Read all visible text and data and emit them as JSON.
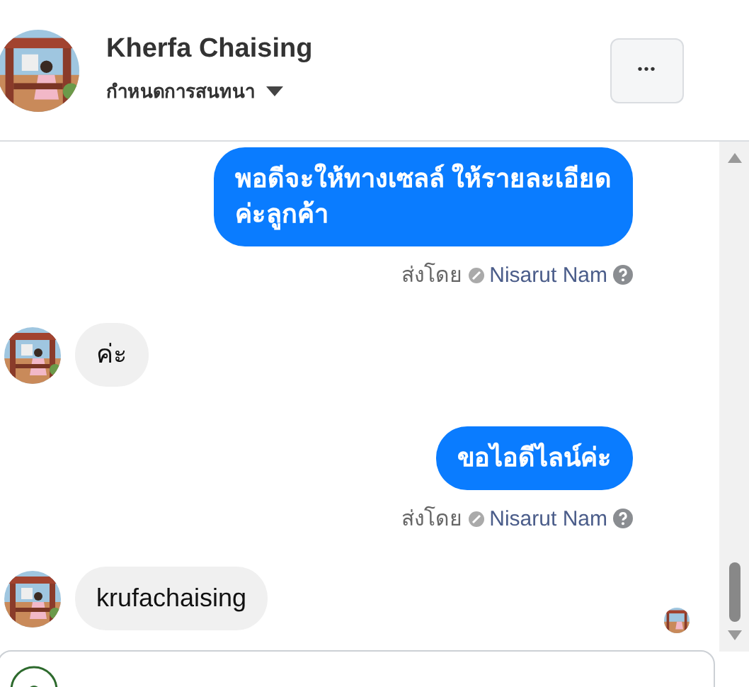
{
  "header": {
    "name": "Kherfa Chaising",
    "subtitle": "กำหนดการสนทนา",
    "more": "•••"
  },
  "messages": [
    {
      "kind": "outgoing",
      "lines": [
        "พอดีจะให้ทางเซลล์ ให้รายละเอียด",
        "ค่ะลูกค้า"
      ],
      "sent_by_label": "ส่งโดย",
      "sender": "Nisarut Nam"
    },
    {
      "kind": "incoming",
      "lines": [
        "ค่ะ"
      ],
      "seen": false
    },
    {
      "kind": "outgoing",
      "lines": [
        "ขอไอดีไลน์ค่ะ"
      ],
      "sent_by_label": "ส่งโดย",
      "sender": "Nisarut Nam"
    },
    {
      "kind": "incoming",
      "lines": [
        "krufachaising"
      ],
      "seen": true
    }
  ]
}
